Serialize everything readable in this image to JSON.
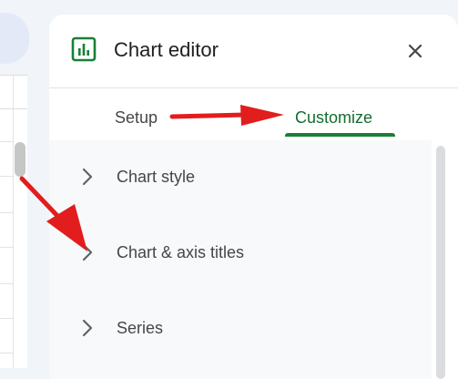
{
  "editor": {
    "title": "Chart editor",
    "icon": "chart-bar-icon",
    "close_icon": "close-icon"
  },
  "tabs": [
    {
      "label": "Setup",
      "active": false
    },
    {
      "label": "Customize",
      "active": true
    }
  ],
  "sections": [
    {
      "label": "Chart style",
      "icon": "chevron-right-icon"
    },
    {
      "label": "Chart & axis titles",
      "icon": "chevron-right-icon"
    },
    {
      "label": "Series",
      "icon": "chevron-right-icon"
    }
  ],
  "colors": {
    "accent_green": "#188038",
    "active_tab_text": "#146c2e",
    "annotation_arrow": "#e21d1d",
    "panel_background": "#ffffff",
    "section_background": "#f8f9fa"
  }
}
